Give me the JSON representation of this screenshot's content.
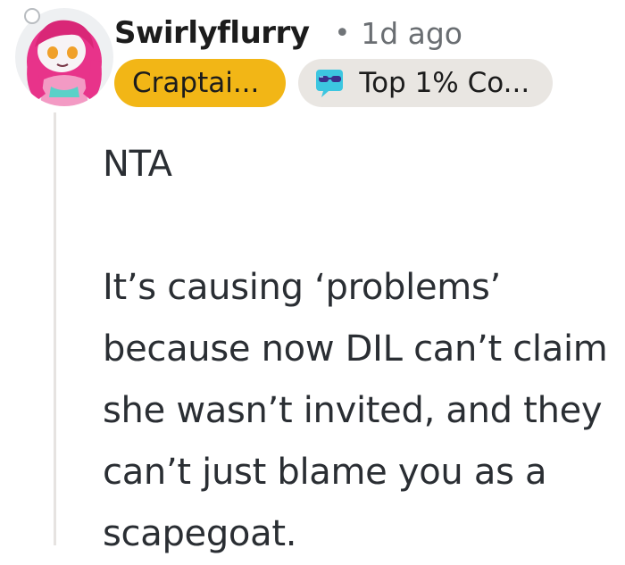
{
  "comment": {
    "author": "Swirlyflurry",
    "separator": "•",
    "timestamp": "1d ago",
    "user_flair": "Craptai...",
    "achievement_flair": "Top 1% Co...",
    "body": [
      "NTA",
      "It’s causing ‘problems’ because now DIL can’t claim she wasn’t invited, and they can’t just blame you as a scapegoat."
    ],
    "icons": {
      "avatar": "snoo-avatar-pink-hair",
      "achievement": "sunglasses-badge-icon"
    },
    "colors": {
      "user_flair_bg": "#f2b616",
      "achievement_flair_bg": "#e9e6e2",
      "thread_line": "#e6e3e1"
    }
  }
}
